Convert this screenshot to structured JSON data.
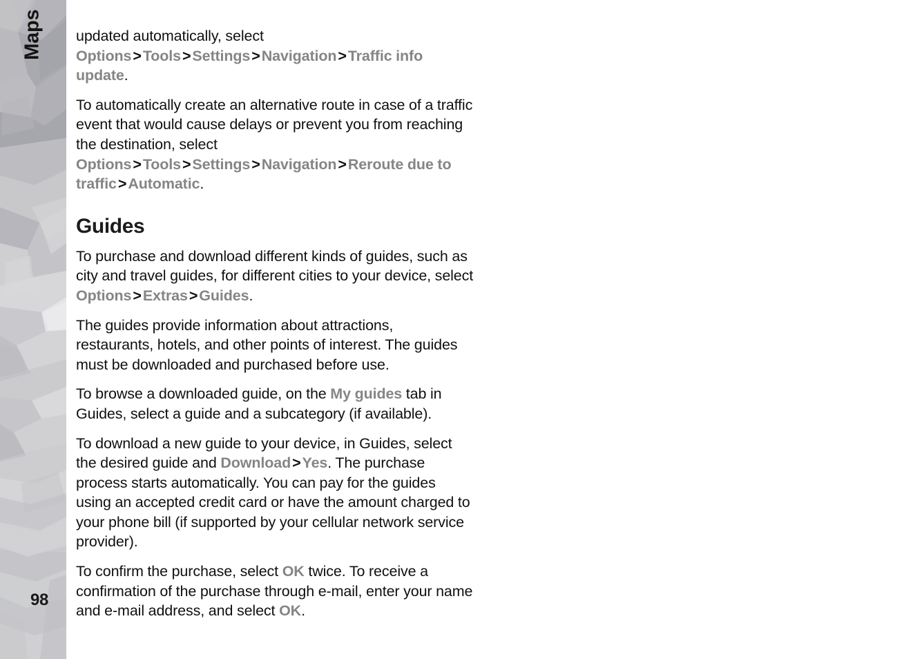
{
  "document": {
    "chapter_label": "Maps",
    "page_number": "98"
  },
  "colors": {
    "ui_term": "#858585",
    "body_text": "#101010",
    "separator": "#111111",
    "sidebar_base": "#c6c6c8",
    "page_background": "#ffffff"
  },
  "content": {
    "blocks": [
      {
        "type": "paragraph",
        "name": "paragraph-traffic-info-update",
        "runs": [
          {
            "kind": "text",
            "text": "updated automatically, select "
          },
          {
            "kind": "ui",
            "text": "Options"
          },
          {
            "kind": "sep",
            "text": ">"
          },
          {
            "kind": "ui",
            "text": "Tools"
          },
          {
            "kind": "sep",
            "text": ">"
          },
          {
            "kind": "ui",
            "text": "Settings"
          },
          {
            "kind": "sep",
            "text": ">"
          },
          {
            "kind": "ui",
            "text": "Navigation"
          },
          {
            "kind": "sep",
            "text": ">"
          },
          {
            "kind": "ui",
            "text": "Traffic info update"
          },
          {
            "kind": "text",
            "text": "."
          }
        ]
      },
      {
        "type": "paragraph",
        "name": "paragraph-reroute-due-to-traffic",
        "runs": [
          {
            "kind": "text",
            "text": "To automatically create an alternative route in case of a traffic event that would cause delays or prevent you from reaching the destination, select "
          },
          {
            "kind": "ui",
            "text": "Options"
          },
          {
            "kind": "sep",
            "text": ">"
          },
          {
            "kind": "ui",
            "text": "Tools"
          },
          {
            "kind": "sep",
            "text": ">"
          },
          {
            "kind": "ui",
            "text": "Settings"
          },
          {
            "kind": "sep",
            "text": ">"
          },
          {
            "kind": "ui",
            "text": "Navigation"
          },
          {
            "kind": "sep",
            "text": ">"
          },
          {
            "kind": "ui",
            "text": "Reroute due to traffic"
          },
          {
            "kind": "sep",
            "text": ">"
          },
          {
            "kind": "ui",
            "text": "Automatic"
          },
          {
            "kind": "text",
            "text": "."
          }
        ]
      },
      {
        "type": "heading",
        "name": "section-heading-guides",
        "text": "Guides"
      },
      {
        "type": "paragraph",
        "name": "paragraph-purchase-download-guides",
        "runs": [
          {
            "kind": "text",
            "text": "To purchase and download different kinds of guides, such as city and travel guides, for different cities to your device, select "
          },
          {
            "kind": "ui",
            "text": "Options"
          },
          {
            "kind": "sep",
            "text": ">"
          },
          {
            "kind": "ui",
            "text": "Extras"
          },
          {
            "kind": "sep",
            "text": ">"
          },
          {
            "kind": "ui",
            "text": "Guides"
          },
          {
            "kind": "text",
            "text": "."
          }
        ]
      },
      {
        "type": "paragraph",
        "name": "paragraph-guides-information",
        "runs": [
          {
            "kind": "text",
            "text": "The guides provide information about attractions, restaurants, hotels, and other points of interest. The guides must be downloaded and purchased before use."
          }
        ]
      },
      {
        "type": "paragraph",
        "name": "paragraph-browse-downloaded-guide",
        "runs": [
          {
            "kind": "text",
            "text": "To browse a downloaded guide, on the "
          },
          {
            "kind": "ui",
            "text": "My guides"
          },
          {
            "kind": "text",
            "text": " tab in Guides, select a guide and a subcategory (if available)."
          }
        ]
      },
      {
        "type": "paragraph",
        "name": "paragraph-download-new-guide",
        "runs": [
          {
            "kind": "text",
            "text": "To download a new guide to your device, in Guides, select the desired guide and "
          },
          {
            "kind": "ui",
            "text": "Download"
          },
          {
            "kind": "sep",
            "text": ">"
          },
          {
            "kind": "ui",
            "text": "Yes"
          },
          {
            "kind": "text",
            "text": ". The purchase process starts automatically. You can pay for the guides using an accepted credit card or have the amount charged to your phone bill (if supported by your cellular network service provider)."
          }
        ]
      },
      {
        "type": "paragraph",
        "name": "paragraph-confirm-purchase",
        "runs": [
          {
            "kind": "text",
            "text": "To confirm the purchase, select "
          },
          {
            "kind": "ui",
            "text": "OK"
          },
          {
            "kind": "text",
            "text": " twice. To receive a confirmation of the purchase through e-mail, enter your name and e-mail address, and select "
          },
          {
            "kind": "ui",
            "text": "OK"
          },
          {
            "kind": "text",
            "text": "."
          }
        ]
      }
    ]
  }
}
